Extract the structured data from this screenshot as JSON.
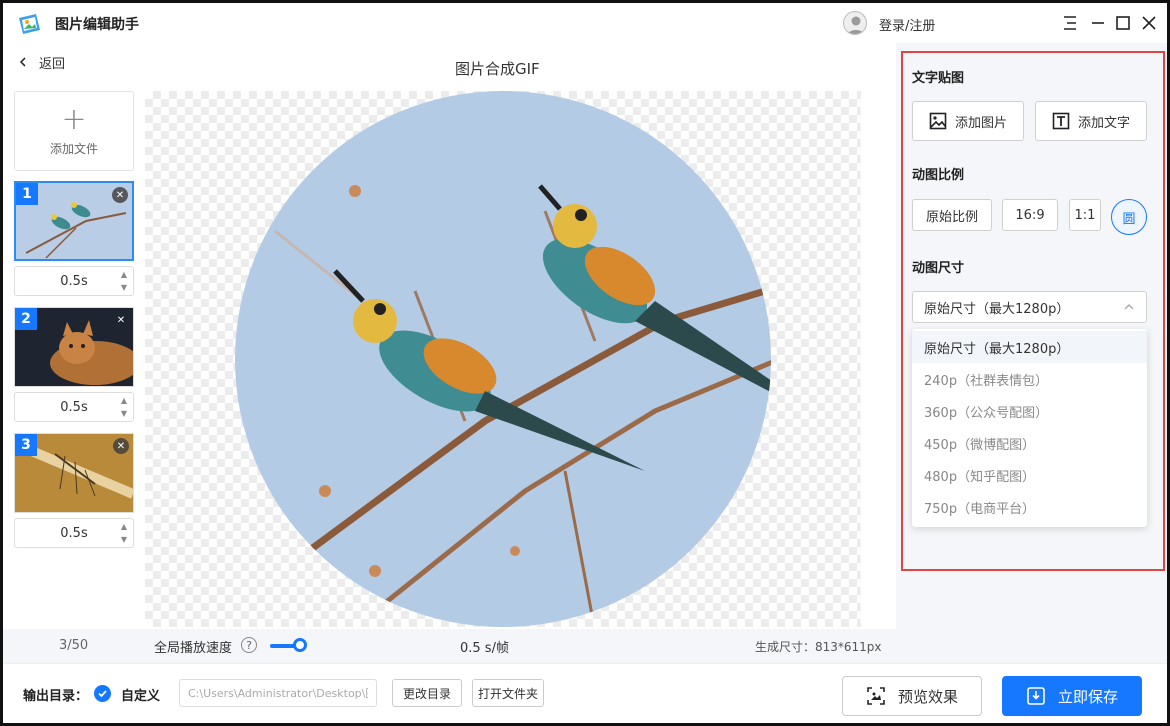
{
  "app": {
    "title": "图片编辑助手",
    "login_label": "登录/注册"
  },
  "icons": {
    "logo": "app-logo-icon",
    "menu": "menu-icon",
    "minimize": "minimize-icon",
    "maximize": "maximize-icon",
    "close": "close-icon"
  },
  "nav": {
    "back_label": "返回"
  },
  "left_panel": {
    "add_file_label": "添加文件",
    "frames": [
      {
        "index": "1",
        "duration": "0.5s",
        "subject": "birds"
      },
      {
        "index": "2",
        "duration": "0.5s",
        "subject": "cat"
      },
      {
        "index": "3",
        "duration": "0.5s",
        "subject": "insect"
      }
    ]
  },
  "canvas": {
    "title": "图片合成GIF"
  },
  "status": {
    "count": "3/50",
    "speed_label": "全局播放速度",
    "speed_value": "0.5 s/帧",
    "gen_size": "生成尺寸：813*611px"
  },
  "right_panel": {
    "sticker_title": "文字贴图",
    "add_image_label": "添加图片",
    "add_text_label": "添加文字",
    "ratio_title": "动图比例",
    "ratio_options": [
      "原始比例",
      "16:9",
      "1:1",
      "圆"
    ],
    "ratio_selected": "圆",
    "size_title": "动图尺寸",
    "size_selected": "原始尺寸（最大1280p）",
    "size_options": [
      "原始尺寸（最大1280p）",
      "240p（社群表情包）",
      "360p（公众号配图）",
      "450p（微博配图）",
      "480p（知乎配图）",
      "750p（电商平台）"
    ]
  },
  "bottom": {
    "output_label": "输出目录：",
    "custom_label": "自定义",
    "path_value": "C:\\Users\\Administrator\\Desktop\\图",
    "change_dir_label": "更改目录",
    "open_folder_label": "打开文件夹",
    "preview_label": "预览效果",
    "save_label": "立即保存"
  },
  "colors": {
    "accent": "#1677ff",
    "highlight_border": "#e04545",
    "panel_bg": "#f4f6f9"
  }
}
